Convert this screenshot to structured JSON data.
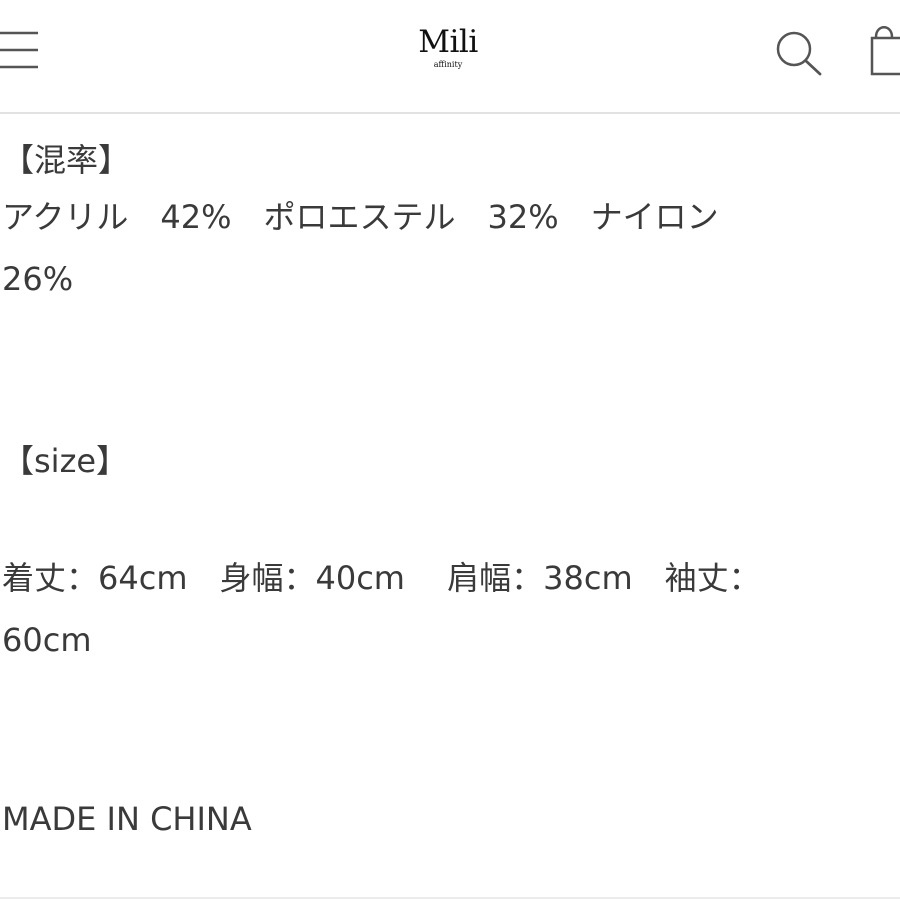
{
  "header": {
    "logo_main": "Mili",
    "logo_sub": "affinity",
    "menu_icon": "hamburger-menu-icon",
    "search_icon": "search-icon",
    "cart_icon": "shopping-bag-icon"
  },
  "product": {
    "composition_heading": "【混率】",
    "composition_line1": "アクリル　42%　ポロエステル　32%　ナイロン",
    "composition_line2": "26%",
    "size_heading": "【size】",
    "size_line1": "着丈：64cm　身幅：40cm　 肩幅：38cm　袖丈：",
    "size_line2": "60cm",
    "origin": "MADE IN CHINA"
  }
}
